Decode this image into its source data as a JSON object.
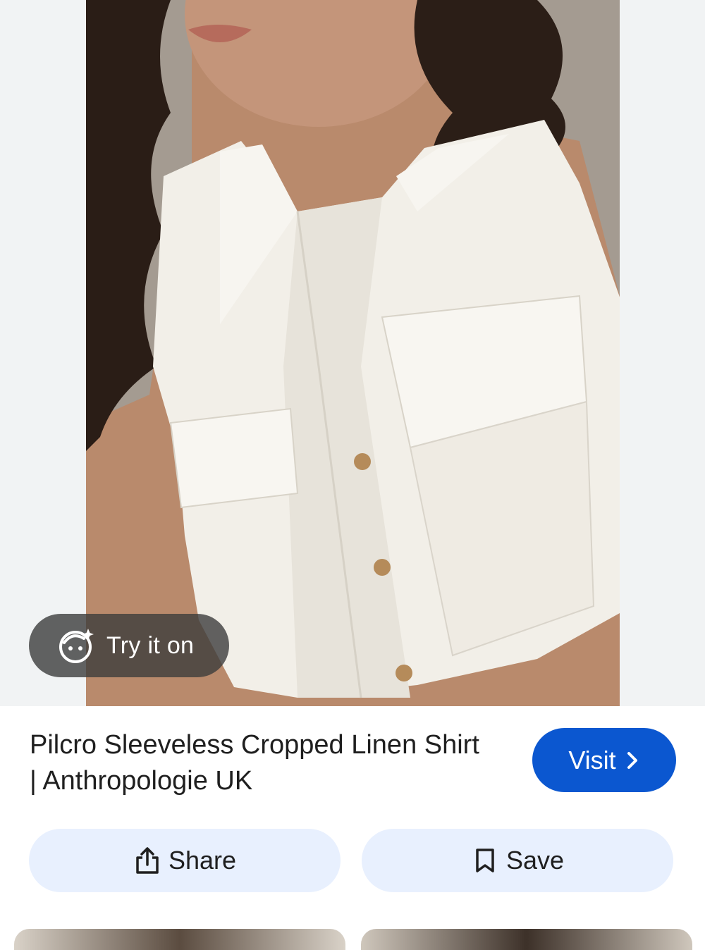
{
  "product": {
    "image_alt": "Model wearing white sleeveless cropped linen shirt",
    "try_on_label": "Try it on",
    "title": "Pilcro Sleeveless Cropped Linen Shirt | Anthropologie UK"
  },
  "actions": {
    "visit_label": "Visit",
    "share_label": "Share",
    "save_label": "Save"
  },
  "colors": {
    "visit_bg": "#0b57d0",
    "action_bg": "#e8f0fe",
    "try_on_bg": "#3c3c3c"
  },
  "icons": {
    "try_on": "face-sparkle-icon",
    "visit": "chevron-right-icon",
    "share": "share-icon",
    "save": "bookmark-icon"
  }
}
